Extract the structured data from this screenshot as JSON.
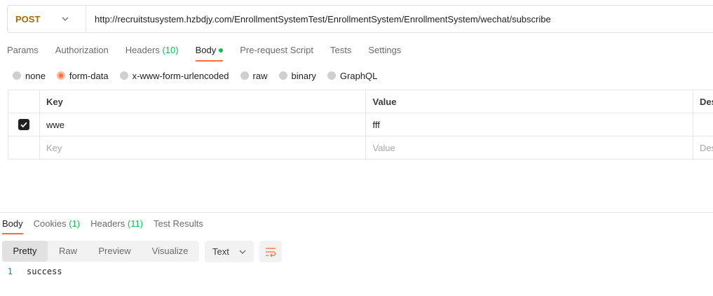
{
  "request": {
    "method": "POST",
    "url": "http://recruitstusystem.hzbdjy.com/EnrollmentSystemTest/EnrollmentSystem/EnrollmentSystem/wechat/subscribe"
  },
  "request_tabs": [
    {
      "label": "Params"
    },
    {
      "label": "Authorization"
    },
    {
      "label": "Headers",
      "count": "(10)"
    },
    {
      "label": "Body"
    },
    {
      "label": "Pre-request Script"
    },
    {
      "label": "Tests"
    },
    {
      "label": "Settings"
    }
  ],
  "body_types": [
    "none",
    "form-data",
    "x-www-form-urlencoded",
    "raw",
    "binary",
    "GraphQL"
  ],
  "body_selected": "form-data",
  "form_table": {
    "headers": {
      "key": "Key",
      "value": "Value",
      "description": "Des"
    },
    "rows": [
      {
        "key": "wwe",
        "value": "fff",
        "checked": true
      }
    ],
    "placeholder": {
      "key": "Key",
      "value": "Value",
      "description": "Des"
    }
  },
  "response_tabs": [
    {
      "label": "Body"
    },
    {
      "label": "Cookies",
      "count": "(1)"
    },
    {
      "label": "Headers",
      "count": "(11)"
    },
    {
      "label": "Test Results"
    }
  ],
  "view_modes": [
    "Pretty",
    "Raw",
    "Preview",
    "Visualize"
  ],
  "format": "Text",
  "response_body": {
    "line": "1",
    "text": "success"
  },
  "colors": {
    "accent": "#ff6c37",
    "method": "#a66a00",
    "count": "#0cbb52"
  }
}
